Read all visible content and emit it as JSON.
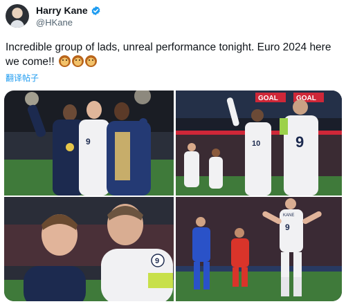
{
  "tweet": {
    "author_name": "Harry Kane",
    "author_handle": "@HKane",
    "text": "Incredible group of lads, unreal performance tonight. Euro 2024 here we come!!",
    "emojis": [
      "lion-face",
      "lion-face",
      "lion-face"
    ],
    "translate_label": "翻译帖子"
  },
  "photos": {
    "p1": {
      "shirt_number": "9"
    },
    "p2": {
      "shirt_number_left": "10",
      "shirt_number_right": "9",
      "banner_text_left": "GOAL",
      "banner_text_right": "GOAL"
    },
    "p3": {
      "shirt_number": "9"
    },
    "p4": {
      "shirt_number": "9",
      "shirt_name": "KANE"
    }
  },
  "colors": {
    "link_blue": "#1d9bf0",
    "verified_blue": "#1d9bf0",
    "text_primary": "#0f1419",
    "text_secondary": "#536471",
    "england_navy": "#1c2a4f",
    "pitch_green": "#3f7a3a"
  }
}
